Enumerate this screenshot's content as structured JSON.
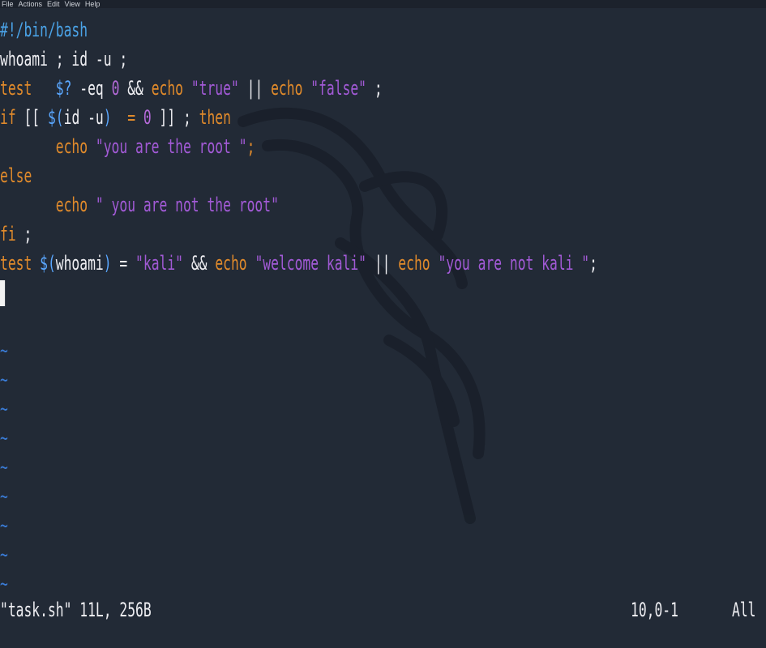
{
  "menu": [
    "File",
    "Actions",
    "Edit",
    "View",
    "Help"
  ],
  "lines": [
    [
      {
        "t": "#!/bin/bash",
        "c": "c-shebang"
      }
    ],
    [
      {
        "t": "whoami ; id -u ;",
        "c": "c-plain"
      }
    ],
    [
      {
        "t": "test   ",
        "c": "c-kw"
      },
      {
        "t": "$?",
        "c": "c-var"
      },
      {
        "t": " -eq ",
        "c": "c-plain"
      },
      {
        "t": "0",
        "c": "c-num"
      },
      {
        "t": " && ",
        "c": "c-plain"
      },
      {
        "t": "echo ",
        "c": "c-kw"
      },
      {
        "t": "\"true\"",
        "c": "c-str"
      },
      {
        "t": " || ",
        "c": "c-plain"
      },
      {
        "t": "echo ",
        "c": "c-kw"
      },
      {
        "t": "\"false\"",
        "c": "c-str"
      },
      {
        "t": " ;",
        "c": "c-plain"
      }
    ],
    [
      {
        "t": "if",
        "c": "c-kw"
      },
      {
        "t": " [[ ",
        "c": "c-plain"
      },
      {
        "t": "$(",
        "c": "c-var"
      },
      {
        "t": "id -u",
        "c": "c-plain"
      },
      {
        "t": ")",
        "c": "c-var"
      },
      {
        "t": "  = ",
        "c": "c-kw"
      },
      {
        "t": "0",
        "c": "c-num"
      },
      {
        "t": " ]] ; ",
        "c": "c-plain"
      },
      {
        "t": "then",
        "c": "c-kw"
      }
    ],
    [
      {
        "t": "       echo ",
        "c": "c-kw"
      },
      {
        "t": "\"you are the root \"",
        "c": "c-str"
      },
      {
        "t": ";",
        "c": "c-kw"
      }
    ],
    [
      {
        "t": "else",
        "c": "c-kw"
      }
    ],
    [
      {
        "t": "       echo ",
        "c": "c-kw"
      },
      {
        "t": "\" you are not the root\"",
        "c": "c-str"
      }
    ],
    [
      {
        "t": "fi",
        "c": "c-kw"
      },
      {
        "t": " ;",
        "c": "c-plain"
      }
    ],
    [
      {
        "t": "test ",
        "c": "c-kw"
      },
      {
        "t": "$(",
        "c": "c-var"
      },
      {
        "t": "whoami",
        "c": "c-plain"
      },
      {
        "t": ")",
        "c": "c-var"
      },
      {
        "t": " = ",
        "c": "c-plain"
      },
      {
        "t": "\"kali\"",
        "c": "c-str"
      },
      {
        "t": " && ",
        "c": "c-plain"
      },
      {
        "t": "echo ",
        "c": "c-kw"
      },
      {
        "t": "\"welcome kali\"",
        "c": "c-str"
      },
      {
        "t": " || ",
        "c": "c-plain"
      },
      {
        "t": "echo ",
        "c": "c-kw"
      },
      {
        "t": "\"you are not kali \"",
        "c": "c-str"
      },
      {
        "t": ";",
        "c": "c-plain"
      }
    ]
  ],
  "tilde_char": "~",
  "tilde_count": 9,
  "status": {
    "message": "\"task.sh\" 11L, 256B",
    "position": "10,0-1",
    "scroll": "All"
  }
}
